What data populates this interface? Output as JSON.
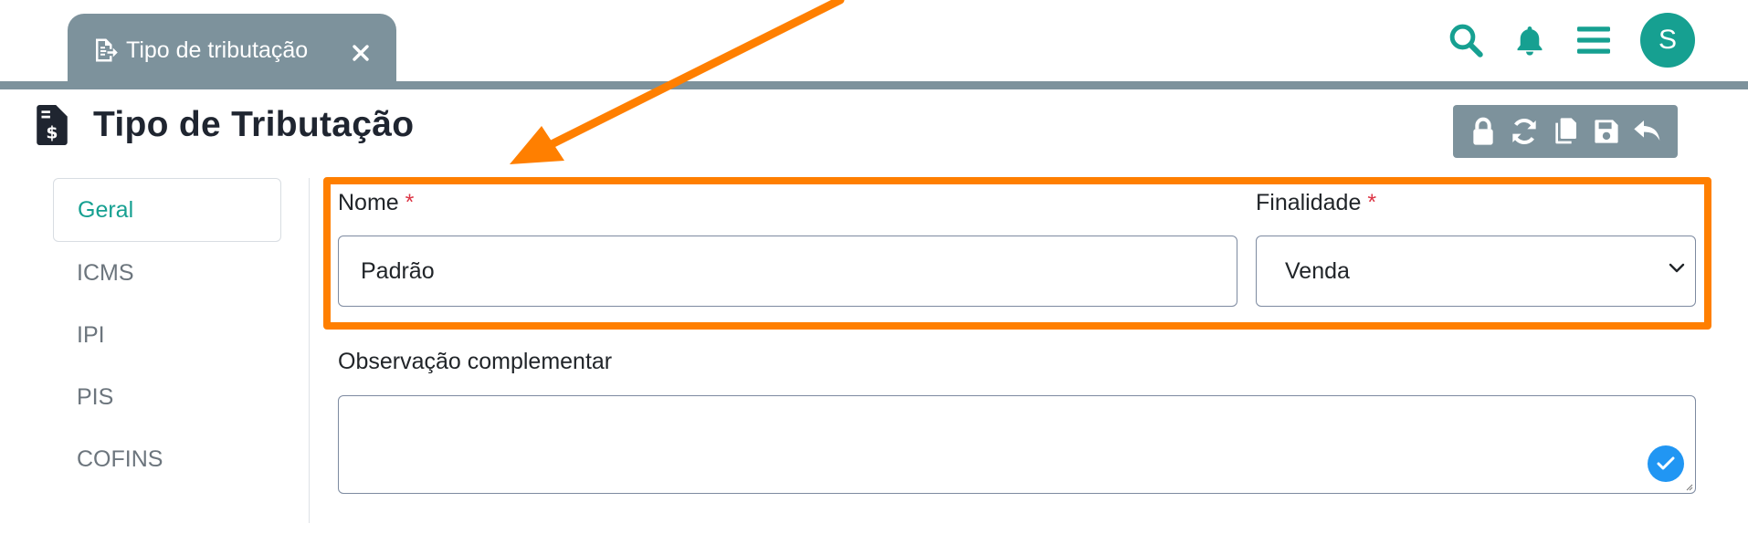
{
  "tabs": [
    {
      "label": "Tipo de tributação",
      "icon": "file-export-icon",
      "close_icon": "close-icon"
    }
  ],
  "header": {
    "icons": [
      "search-icon",
      "bell-icon",
      "menu-icon"
    ],
    "avatar_initial": "S"
  },
  "page": {
    "title": "Tipo de Tributação",
    "title_icon": "file-invoice-dollar-icon"
  },
  "toolbar": {
    "buttons": [
      "lock-icon",
      "sync-icon",
      "copy-icon",
      "save-icon",
      "undo-icon"
    ]
  },
  "sidenav": {
    "items": [
      {
        "label": "Geral",
        "active": true
      },
      {
        "label": "ICMS",
        "active": false
      },
      {
        "label": "IPI",
        "active": false
      },
      {
        "label": "PIS",
        "active": false
      },
      {
        "label": "COFINS",
        "active": false
      }
    ]
  },
  "form": {
    "nome": {
      "label": "Nome",
      "required_mark": "*",
      "value": "Padrão"
    },
    "finalidade": {
      "label": "Finalidade",
      "required_mark": "*",
      "value": "Venda"
    },
    "observacao": {
      "label": "Observação complementar",
      "value": ""
    }
  },
  "colors": {
    "accent": "#16a091",
    "tab_bar": "#7d929c",
    "highlight": "#ff7f00",
    "required": "#dc3545",
    "check": "#2196f3"
  }
}
